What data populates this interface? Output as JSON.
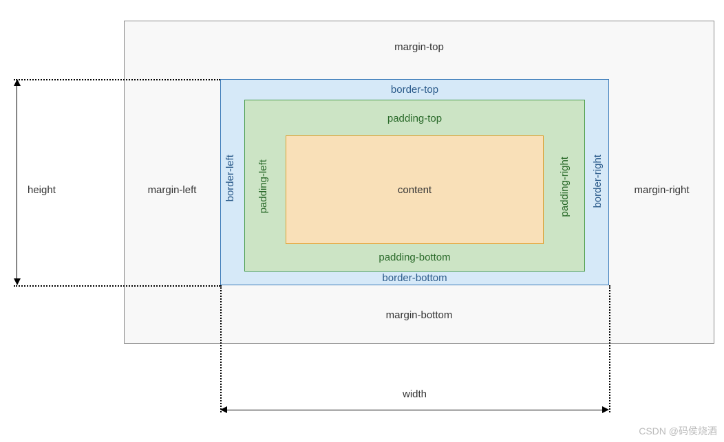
{
  "boxmodel": {
    "margin": {
      "top": "margin-top",
      "right": "margin-right",
      "bottom": "margin-bottom",
      "left": "margin-left"
    },
    "border": {
      "top": "border-top",
      "right": "border-right",
      "bottom": "border-bottom",
      "left": "border-left"
    },
    "padding": {
      "top": "padding-top",
      "right": "padding-right",
      "bottom": "padding-bottom",
      "left": "padding-left"
    },
    "content": "content"
  },
  "dimensions": {
    "height": "height",
    "width": "width"
  },
  "watermark": "CSDN @码侯烧酒"
}
